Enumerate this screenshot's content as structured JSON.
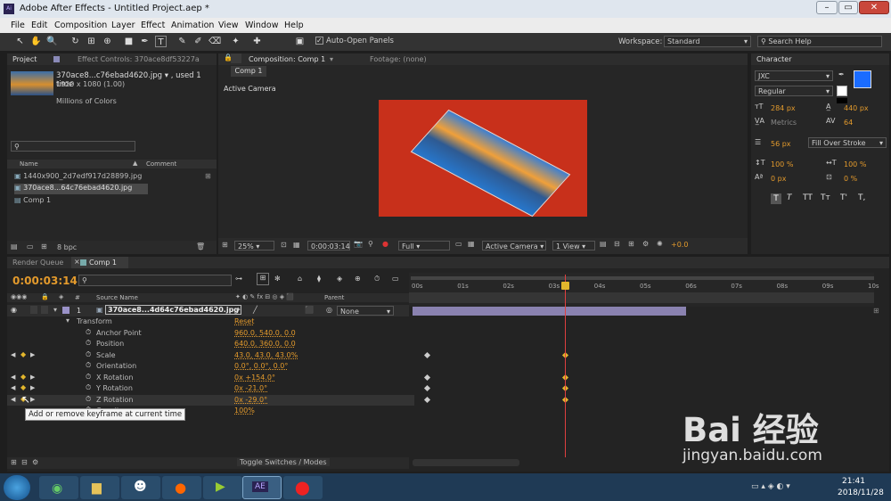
{
  "window": {
    "title": "Adobe After Effects - Untitled Project.aep *",
    "app_icon": "Ai"
  },
  "menu": [
    "File",
    "Edit",
    "Composition",
    "Layer",
    "Effect",
    "Animation",
    "View",
    "Window",
    "Help"
  ],
  "toolbar": {
    "auto_open": "Auto-Open Panels",
    "workspace_label": "Workspace:",
    "workspace_value": "Standard",
    "search_help": "Search Help"
  },
  "project": {
    "tab": "Project",
    "tab2": "Effect Controls: 370ace8df53227a",
    "file_name": "370ace8...c76ebad4620.jpg ▾ , used 1 time",
    "file_dims": "1920 x 1080 (1.00)",
    "file_colors": "Millions of Colors",
    "col_name": "Name",
    "col_comment": "Comment",
    "items": [
      "1440x900_2d7edf917d28899.jpg",
      "370ace8...64c76ebad4620.jpg",
      "Comp 1"
    ],
    "bpc": "8 bpc"
  },
  "composition": {
    "tab": "Composition: Comp 1",
    "footage": "Footage: (none)",
    "subtab": "Comp 1",
    "camera_label": "Active Camera",
    "zoom": "25%",
    "timecode": "0:00:03:14",
    "res": "Full",
    "camera": "Active Camera",
    "view": "1 View",
    "offset": "+0.0"
  },
  "character": {
    "tab": "Character",
    "font": "JXC",
    "style": "Regular",
    "size": "284 px",
    "leading": "440 px",
    "kerning": "Metrics",
    "tracking": "64",
    "stroke_w": "56 px",
    "stroke_mode": "Fill Over Stroke",
    "vscale": "100 %",
    "hscale": "100 %",
    "baseline": "0 px",
    "tsume": "0 %",
    "fill_color": "#1a6cff",
    "styles": [
      "T",
      "T",
      "TT",
      "Tт",
      "T'",
      "T,"
    ]
  },
  "timeline": {
    "tab1": "Render Queue",
    "tab2": "Comp 1",
    "timecode": "0:00:03:14",
    "col_source": "Source Name",
    "col_parent": "Parent",
    "ruler": [
      "00s",
      "01s",
      "02s",
      "03s",
      "04s",
      "05s",
      "06s",
      "07s",
      "08s",
      "09s",
      "10s"
    ],
    "layer": {
      "num": "1",
      "name": "370ace8...4d64c76ebad4620.jpg",
      "parent": "None"
    },
    "props": [
      {
        "name": "Transform",
        "value": "Reset"
      },
      {
        "name": "Anchor Point",
        "value": "960.0, 540.0, 0.0"
      },
      {
        "name": "Position",
        "value": "640.0, 360.0, 0.0"
      },
      {
        "name": "Scale",
        "value": "43.0, 43.0, 43.0%"
      },
      {
        "name": "Orientation",
        "value": "0.0°, 0.0°, 0.0°"
      },
      {
        "name": "X Rotation",
        "value": "0x +154.0°"
      },
      {
        "name": "Y Rotation",
        "value": "0x -21.0°"
      },
      {
        "name": "Z Rotation",
        "value": "0x -29.0°"
      },
      {
        "name": "Opacity",
        "value": "100%"
      }
    ],
    "tooltip": "Add or remove keyframe at current time",
    "toggle": "Toggle Switches / Modes",
    "current_time_sec": 3.28
  },
  "taskbar": {
    "time": "21:41",
    "date": "2018/11/28"
  },
  "watermark": {
    "brand": "Bai 经验",
    "url": "jingyan.baidu.com"
  }
}
